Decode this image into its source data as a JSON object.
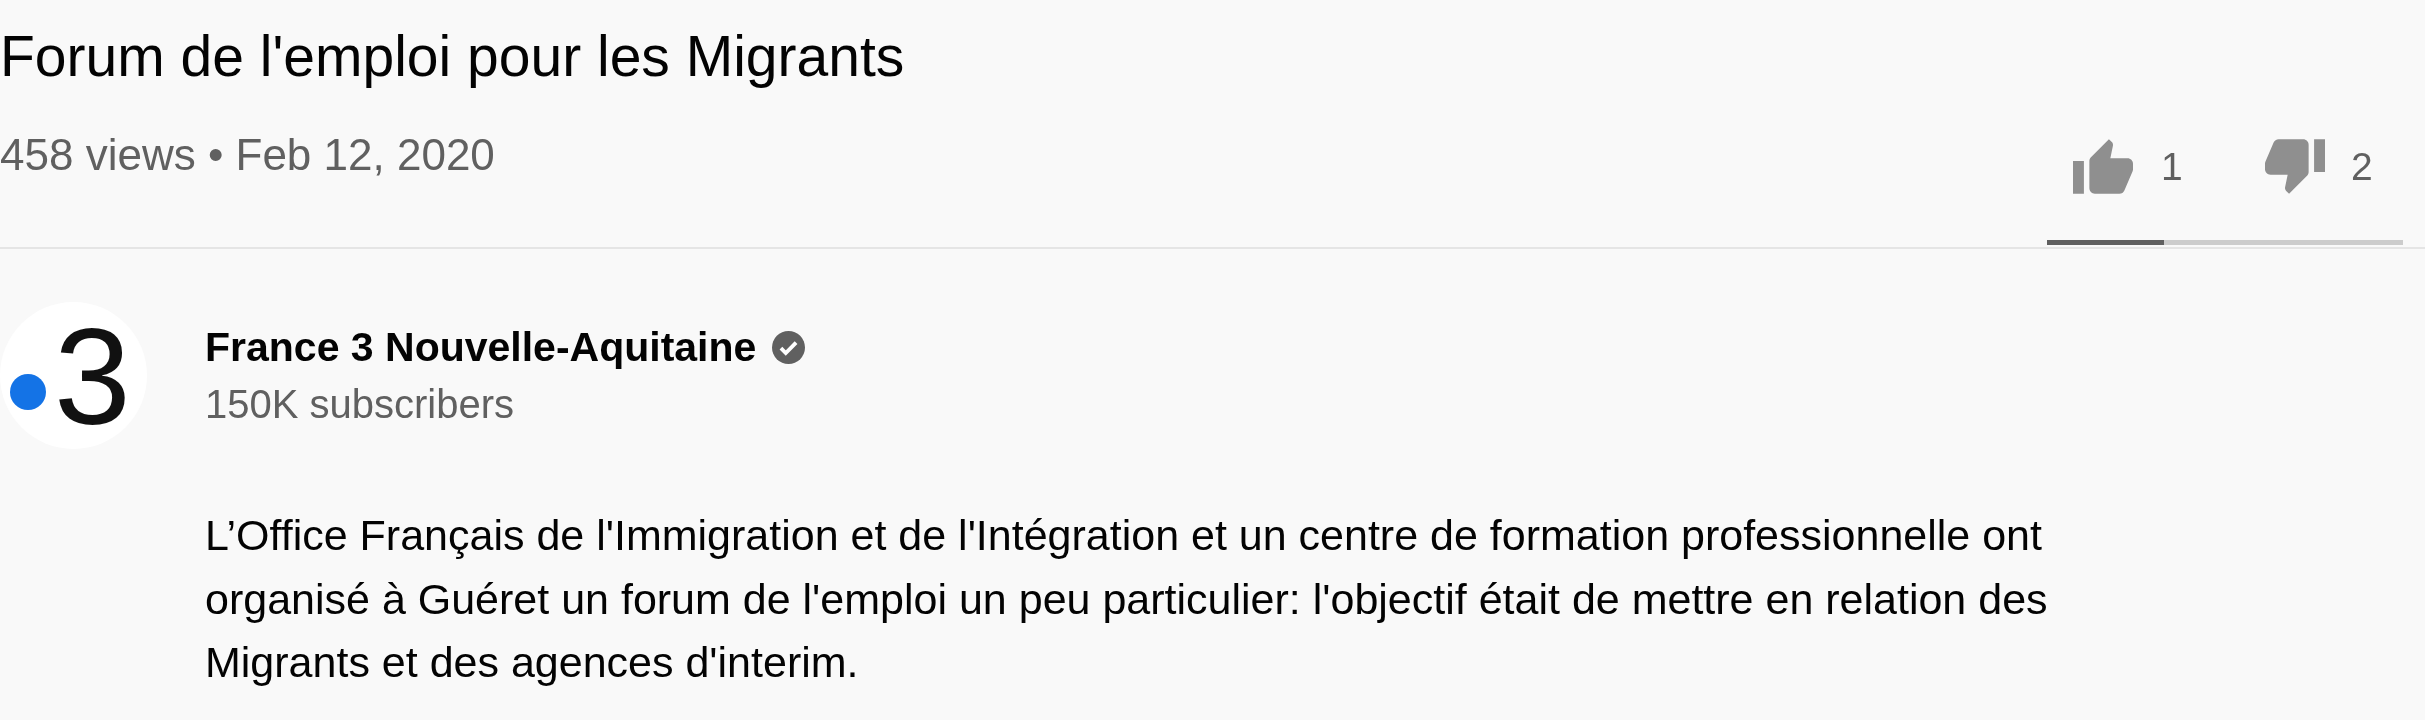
{
  "video": {
    "title": "Forum de l'emploi pour les Migrants",
    "info": "458 views • Feb 12, 2020"
  },
  "rating": {
    "likes": "1",
    "dislikes": "2",
    "sentiment_bar": {
      "level": 0.33
    }
  },
  "channel": {
    "logo_text": "3",
    "name": "France 3 Nouvelle-Aquitaine",
    "verified": true,
    "subscribers": "150K subscribers"
  },
  "description": "L’Office Français de l'Immigration et de l'Intégration et un centre de formation professionnelle ont organisé à Guéret un forum de l'emploi un peu particulier: l'objectif était de mettre en relation des Migrants et des agences d'interim."
}
